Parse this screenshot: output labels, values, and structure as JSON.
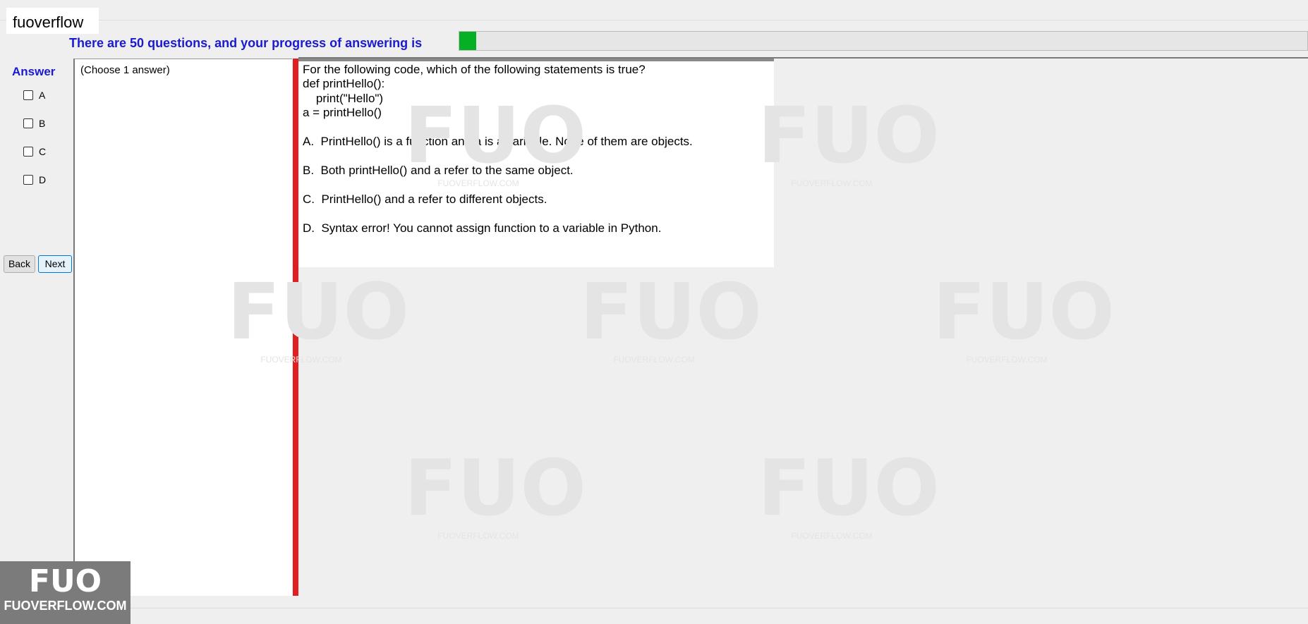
{
  "brand": "fuoverflow",
  "header": {
    "progress_text": "There are 50 questions, and your progress of answering is",
    "progress_fraction": 0.02,
    "progress_color": "#06b025"
  },
  "answer_panel": {
    "title": "Answer",
    "options": [
      "A",
      "B",
      "C",
      "D"
    ]
  },
  "navigation": {
    "back_label": "Back",
    "next_label": "Next"
  },
  "left_panel": {
    "choose_label": "(Choose 1 answer)"
  },
  "question": {
    "lines": [
      "For the following code, which of the following statements is true?",
      "def printHello():",
      "    print(\"Hello\")",
      "a = printHello()",
      "A.  PrintHello() is a function and a is a variable. None of them are objects.",
      "B.  Both printHello() and a refer to the same object.",
      "C.  PrintHello() and a refer to different objects.",
      "D.  Syntax error! You cannot assign function to a variable in Python."
    ]
  },
  "watermark": {
    "logo": "FUO",
    "text": "FUOVERFLOW.COM"
  },
  "corner_logo": {
    "big": "FUO",
    "small": "FUOVERFLOW.COM"
  },
  "colors": {
    "accent_blue": "#1a1ad2",
    "separator_red": "#e02020"
  }
}
